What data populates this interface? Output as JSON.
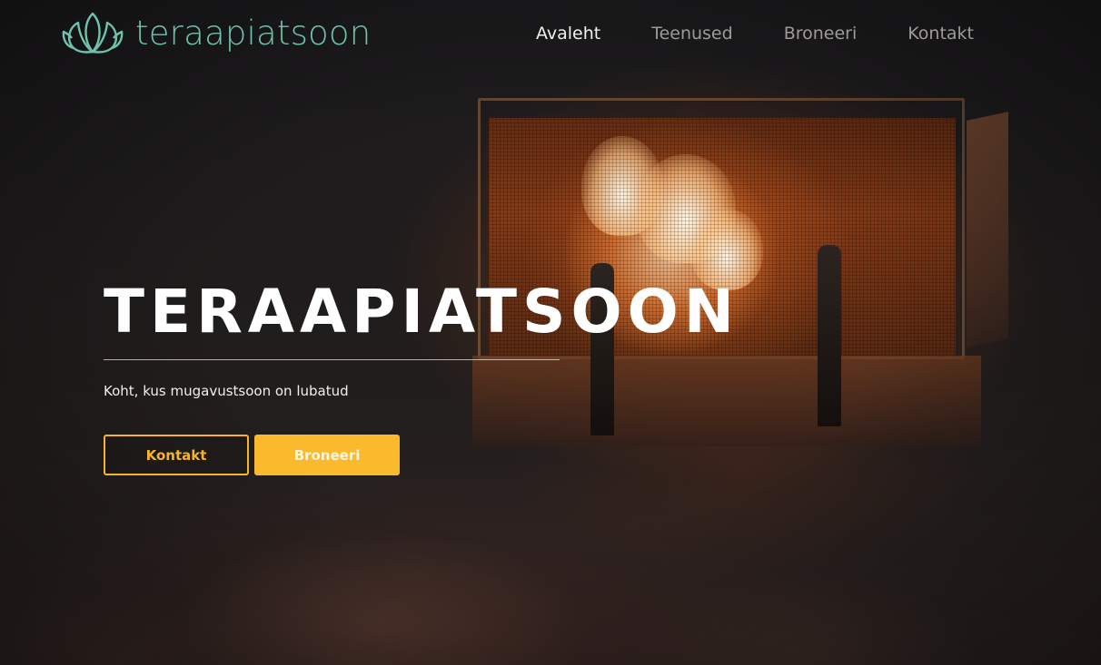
{
  "header": {
    "brand_name": "teraapiatsoon",
    "logo_icon": "lotus-icon",
    "nav": [
      {
        "label": "Avaleht",
        "active": true
      },
      {
        "label": "Teenused",
        "active": false
      },
      {
        "label": "Broneeri",
        "active": false
      },
      {
        "label": "Kontakt",
        "active": false
      }
    ]
  },
  "hero": {
    "title": "TERAAPIATSOON",
    "subtitle": "Koht, kus mugavustsoon on lubatud",
    "buttons": {
      "contact_label": "Kontakt",
      "book_label": "Broneeri"
    }
  },
  "colors": {
    "brand_teal": "#6fc3ab",
    "accent_yellow": "#fbb92e",
    "nav_active": "#f2f0ee",
    "nav_inactive": "#9e9a98",
    "background": "#201d1e"
  }
}
